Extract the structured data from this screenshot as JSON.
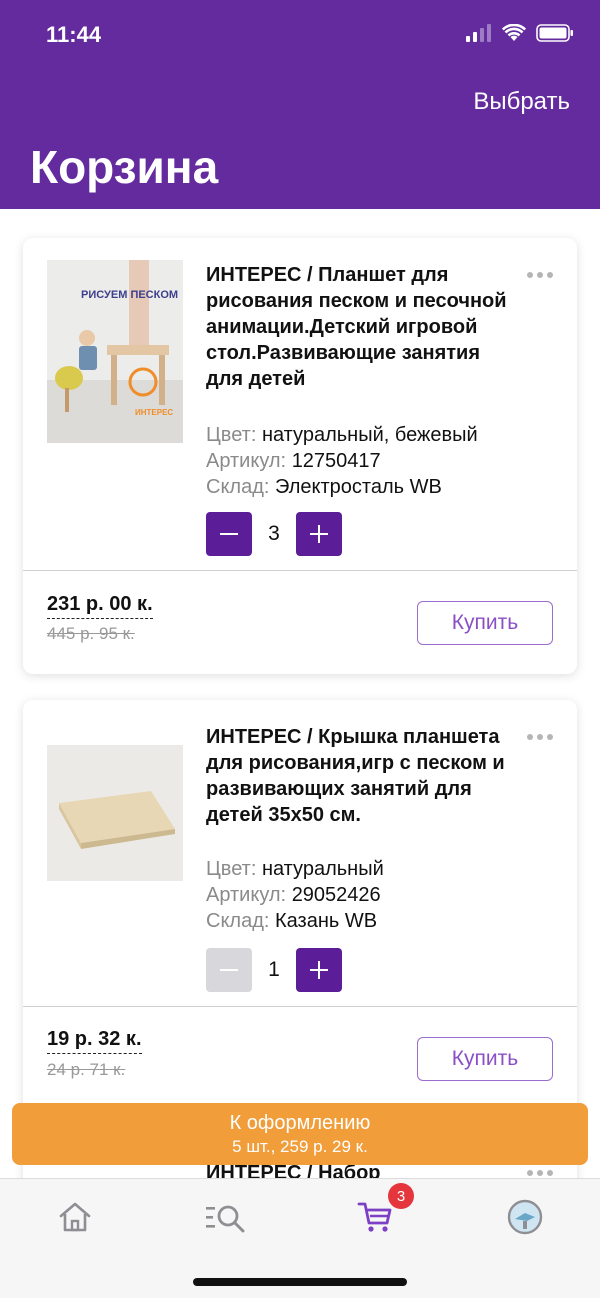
{
  "status": {
    "time": "11:44"
  },
  "header": {
    "select_label": "Выбрать",
    "title": "Корзина"
  },
  "items": [
    {
      "title": "ИНТЕРЕС / Планшет для рисования песком и песочной анимации.Детский игровой стол.Развивающие занятия для детей",
      "image_text": "РИСУЕМ ПЕСКОМ",
      "image_logo": "ИНТЕРЕС",
      "color_key": "Цвет:",
      "color": "натуральный, бежевый",
      "sku_key": "Артикул:",
      "sku": "12750417",
      "warehouse_key": "Склад:",
      "warehouse": "Электросталь WB",
      "quantity": "3",
      "minus_enabled": true,
      "price": "231 р. 00 к.",
      "old_price": "445 р. 95 к.",
      "buy_label": "Купить"
    },
    {
      "title": "ИНТЕРЕС / Крышка планшета для рисования,игр с песком и развивающих занятий для детей 35х50 см.",
      "color_key": "Цвет:",
      "color": "натуральный",
      "sku_key": "Артикул:",
      "sku": "29052426",
      "warehouse_key": "Склад:",
      "warehouse": "Казань WB",
      "quantity": "1",
      "minus_enabled": false,
      "price": "19 р. 32 к.",
      "old_price": "24 р. 71 к.",
      "buy_label": "Купить"
    },
    {
      "title": "ИНТЕРЕС / Набор"
    }
  ],
  "checkout": {
    "label": "К оформлению",
    "summary": "5 шт., 259 р. 29 к."
  },
  "tabbar": {
    "tabs": [
      {
        "icon": "home-icon"
      },
      {
        "icon": "catalog-search-icon"
      },
      {
        "icon": "cart-icon",
        "active": true,
        "badge": "3"
      },
      {
        "icon": "profile-avatar-icon"
      }
    ]
  },
  "colors": {
    "header": "#632b9e",
    "accent": "#5b1d98",
    "checkout": "#f09d3a",
    "badge": "#e5353d"
  }
}
